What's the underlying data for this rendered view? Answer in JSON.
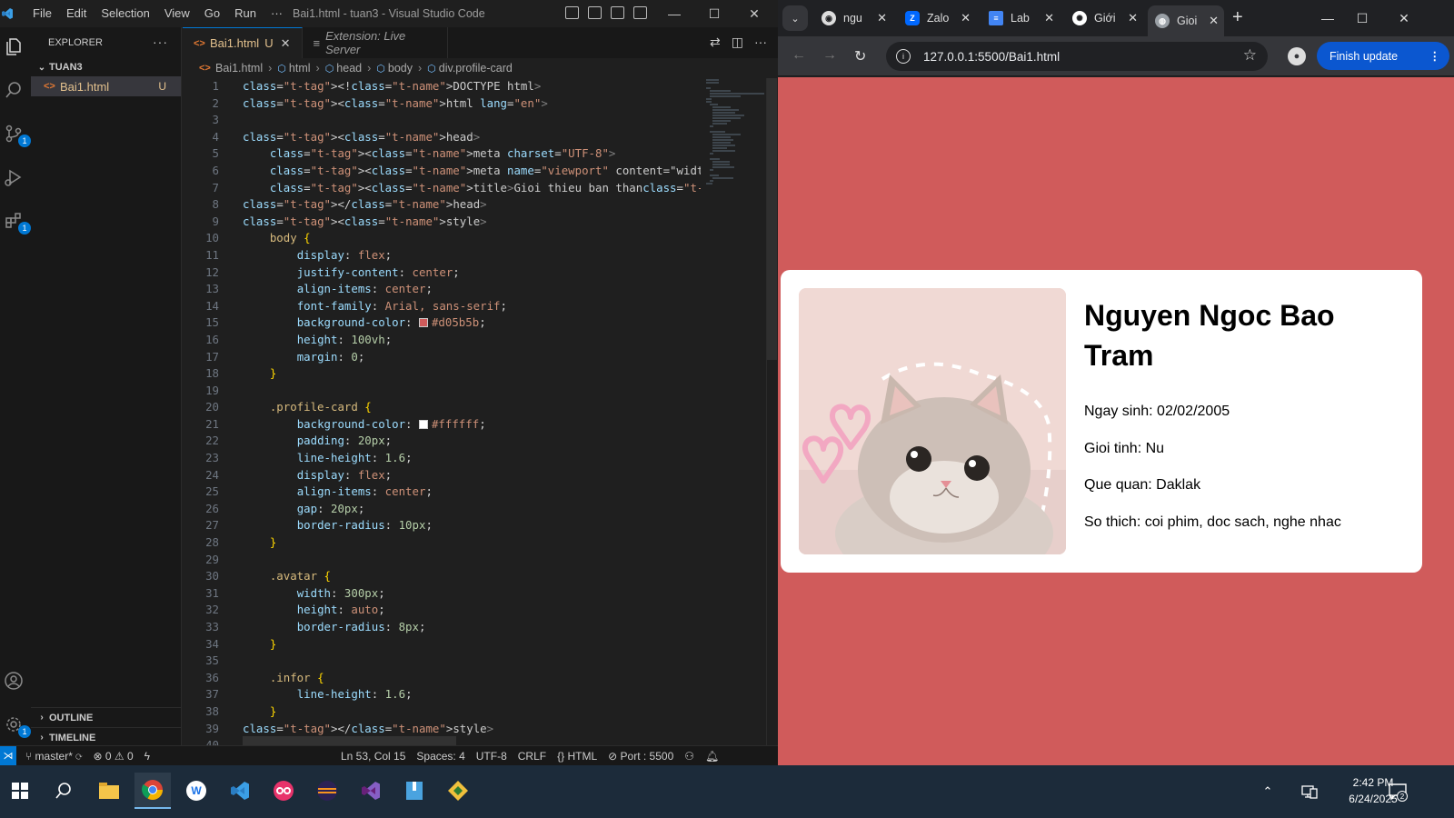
{
  "vscode": {
    "menu": [
      "File",
      "Edit",
      "Selection",
      "View",
      "Go",
      "Run",
      "···"
    ],
    "title": "Bai1.html - tuan3 - Visual Studio Code",
    "explorer_title": "EXPLORER",
    "folder": "TUAN3",
    "file": {
      "name": "Bai1.html",
      "status": "U"
    },
    "outline": "OUTLINE",
    "timeline": "TIMELINE",
    "activity_badges": {
      "scm": "1",
      "extensions": "1",
      "settings": "1"
    },
    "tabs": [
      {
        "label": "Bai1.html",
        "status": "U",
        "active": true
      },
      {
        "label": "Extension: Live Server",
        "active": false
      }
    ],
    "breadcrumb": [
      "Bai1.html",
      "html",
      "head",
      "body",
      "div.profile-card"
    ],
    "code_lines": [
      "<!DOCTYPE html>",
      "<html lang=\"en\">",
      "",
      "<head>",
      "    <meta charset=\"UTF-8\">",
      "    <meta name=\"viewport\" content=\"width=device-width, initial-scal",
      "    <title>Gioi thieu ban than</title>",
      "</head>",
      "<style>",
      "    body {",
      "        display: flex;",
      "        justify-content: center;",
      "        align-items: center;",
      "        font-family: Arial, sans-serif;",
      "        background-color: #d05b5b;",
      "        height: 100vh;",
      "        margin: 0;",
      "    }",
      "",
      "    .profile-card {",
      "        background-color: #ffffff;",
      "        padding: 20px;",
      "        line-height: 1.6;",
      "        display: flex;",
      "        align-items: center;",
      "        gap: 20px;",
      "        border-radius: 10px;",
      "    }",
      "",
      "    .avatar {",
      "        width: 300px;",
      "        height: auto;",
      "        border-radius: 8px;",
      "    }",
      "",
      "    .infor {",
      "        line-height: 1.6;",
      "    }",
      "</style>",
      ""
    ],
    "status": {
      "branch": "master*",
      "errors": "0",
      "warnings": "0",
      "position": "Ln 53, Col 15",
      "spaces": "Spaces: 4",
      "encoding": "UTF-8",
      "eol": "CRLF",
      "language": "HTML",
      "port": "Port : 5500"
    }
  },
  "browser": {
    "tabs": [
      {
        "label": "ngu",
        "favicon": "github-icon"
      },
      {
        "label": "Zalo",
        "favicon": "zalo-icon"
      },
      {
        "label": "Lab",
        "favicon": "docs-icon"
      },
      {
        "label": "Giới",
        "favicon": "chatgpt-icon"
      },
      {
        "label": "Gioi",
        "favicon": "globe-icon",
        "active": true
      }
    ],
    "url": "127.0.0.1:5500/Bai1.html",
    "finish_update": "Finish update",
    "page": {
      "background": "#d05b5b",
      "card_background": "#ffffff",
      "name": "Nguyen Ngoc Bao Tram",
      "info": [
        "Ngay sinh: 02/02/2005",
        "Gioi tinh: Nu",
        "Que quan: Daklak",
        "So thich: coi phim, doc sach, nghe nhac"
      ]
    }
  },
  "taskbar": {
    "time": "2:42 PM",
    "date": "6/24/2025",
    "notification_count": "2"
  }
}
